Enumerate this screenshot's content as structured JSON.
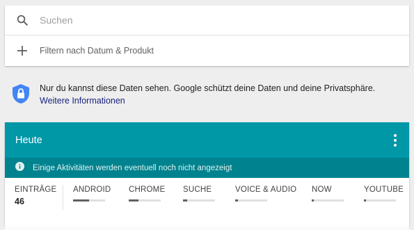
{
  "search": {
    "placeholder": "Suchen"
  },
  "filter": {
    "label": "Filtern nach Datum & Produkt"
  },
  "privacy": {
    "text": "Nur du kannst diese Daten sehen. Google schützt deine Daten und deine Privatsphäre.",
    "link": "Weitere Informationen"
  },
  "day": {
    "title": "Heute",
    "notice": "Einige Aktivitäten werden eventuell noch nicht angezeigt",
    "header_color": "#0097a7",
    "notice_color": "#00838f"
  },
  "stats": {
    "entries_label": "EINTRÄGE",
    "entries_count": "46",
    "products": [
      {
        "label": "ANDROID",
        "share": 0.5
      },
      {
        "label": "CHROME",
        "share": 0.3
      },
      {
        "label": "SUCHE",
        "share": 0.12
      },
      {
        "label": "VOICE & AUDIO",
        "share": 0.08
      },
      {
        "label": "NOW",
        "share": 0.06
      },
      {
        "label": "YOUTUBE",
        "share": 0.06
      }
    ]
  },
  "icons": [
    "search-icon",
    "plus-icon",
    "shield-lock-icon",
    "more-vert-icon",
    "info-icon"
  ]
}
